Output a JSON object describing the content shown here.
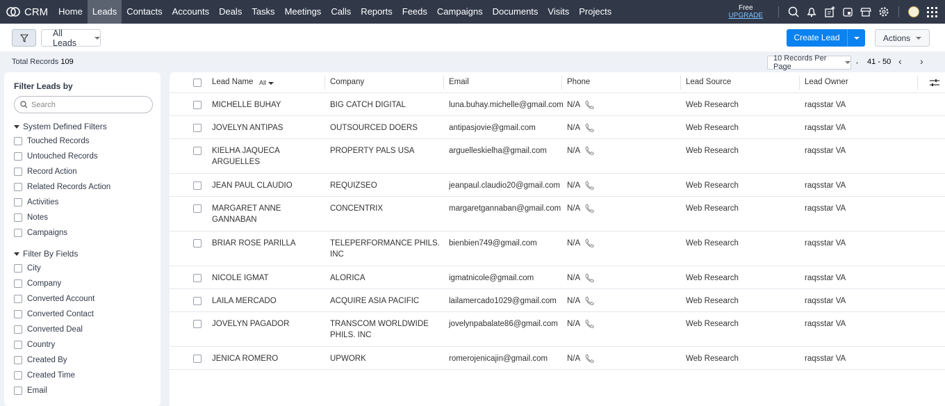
{
  "topbar": {
    "app": "CRM",
    "nav": [
      "Home",
      "Leads",
      "Contacts",
      "Accounts",
      "Deals",
      "Tasks",
      "Meetings",
      "Calls",
      "Reports",
      "Feeds",
      "Campaigns",
      "Documents",
      "Visits",
      "Projects"
    ],
    "active": "Leads",
    "plan": "Free",
    "upgrade": "UPGRADE"
  },
  "toolbar": {
    "view": "All Leads",
    "create": "Create Lead",
    "actions": "Actions"
  },
  "pager": {
    "total_label": "Total Records",
    "total": "109",
    "per_page": "10 Records Per Page",
    "range": "41 - 50"
  },
  "sidebar": {
    "title": "Filter Leads by",
    "search_placeholder": "Search",
    "system_title": "System Defined Filters",
    "system": [
      "Touched Records",
      "Untouched Records",
      "Record Action",
      "Related Records Action",
      "Activities",
      "Notes",
      "Campaigns"
    ],
    "fields_title": "Filter By Fields",
    "fields": [
      "City",
      "Company",
      "Converted Account",
      "Converted Contact",
      "Converted Deal",
      "Country",
      "Created By",
      "Created Time",
      "Email"
    ]
  },
  "table": {
    "columns": [
      "Lead Name",
      "Company",
      "Email",
      "Phone",
      "Lead Source",
      "Lead Owner"
    ],
    "name_filter": "All",
    "rows": [
      {
        "name": "MICHELLE BUHAY",
        "company": "BIG CATCH DIGITAL",
        "email": "luna.buhay.michelle@gmail.com",
        "phone": "N/A",
        "source": "Web Research",
        "owner": "raqsstar VA"
      },
      {
        "name": "JOVELYN ANTIPAS",
        "company": "OUTSOURCED DOERS",
        "email": "antipasjovie@gmail.com",
        "phone": "N/A",
        "source": "Web Research",
        "owner": "raqsstar VA"
      },
      {
        "name": "KIELHA JAQUECA\nARGUELLES",
        "company": "PROPERTY PALS USA",
        "email": "arguelleskielha@gmail.com",
        "phone": "N/A",
        "source": "Web Research",
        "owner": "raqsstar VA"
      },
      {
        "name": "JEAN PAUL CLAUDIO",
        "company": "REQUIZSEO",
        "email": "jeanpaul.claudio20@gmail.com",
        "phone": "N/A",
        "source": "Web Research",
        "owner": "raqsstar VA"
      },
      {
        "name": "MARGARET ANNE\nGANNABAN",
        "company": "CONCENTRIX",
        "email": "margaretgannaban@gmail.com",
        "phone": "N/A",
        "source": "Web Research",
        "owner": "raqsstar VA"
      },
      {
        "name": "BRIAR ROSE PARILLA",
        "company": "TELEPERFORMANCE PHILS.\nINC",
        "email": "bienbien749@gmail.com",
        "phone": "N/A",
        "source": "Web Research",
        "owner": "raqsstar VA"
      },
      {
        "name": "NICOLE IGMAT",
        "company": "ALORICA",
        "email": "igmatnicole@gmail.com",
        "phone": "N/A",
        "source": "Web Research",
        "owner": "raqsstar VA"
      },
      {
        "name": "LAILA MERCADO",
        "company": "ACQUIRE ASIA PACIFIC",
        "email": "lailamercado1029@gmail.com",
        "phone": "N/A",
        "source": "Web Research",
        "owner": "raqsstar VA"
      },
      {
        "name": "JOVELYN PAGADOR",
        "company": "TRANSCOM WORLDWIDE\nPHILS. INC",
        "email": "jovelynpabalate86@gmail.com",
        "phone": "N/A",
        "source": "Web Research",
        "owner": "raqsstar VA"
      },
      {
        "name": "JENICA ROMERO",
        "company": "UPWORK",
        "email": "romerojenicajin@gmail.com",
        "phone": "N/A",
        "source": "Web Research",
        "owner": "raqsstar VA"
      }
    ]
  }
}
